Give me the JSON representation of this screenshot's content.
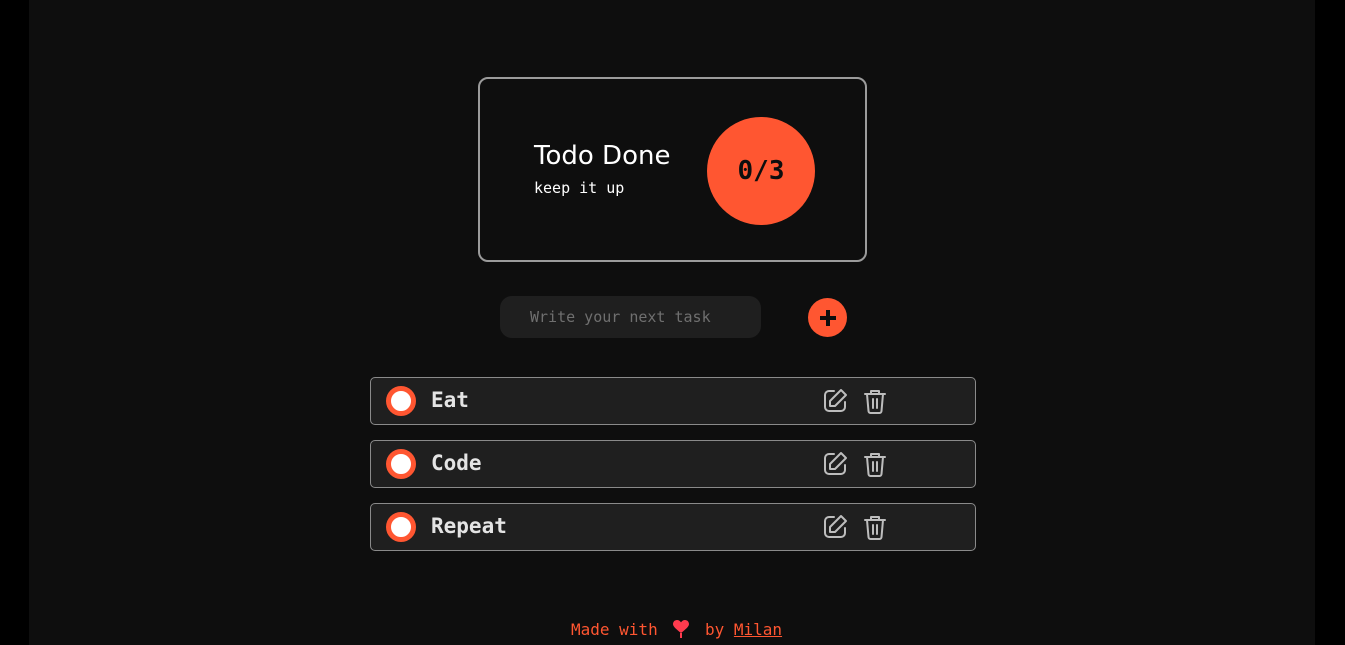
{
  "stats": {
    "title": "Todo Done",
    "subtitle": "keep it up",
    "count": "0/3",
    "done": 0,
    "total": 3
  },
  "input": {
    "placeholder": "Write your next task",
    "value": ""
  },
  "add_button": {
    "icon": "plus-icon"
  },
  "todos": [
    {
      "text": "Eat",
      "done": false
    },
    {
      "text": "Code",
      "done": false
    },
    {
      "text": "Repeat",
      "done": false
    }
  ],
  "footer": {
    "prefix": "Made with",
    "by": "by",
    "author": "Milan",
    "heart_icon": "heart-icon"
  },
  "colors": {
    "accent": "#ff5631",
    "background": "#0e0e0e",
    "card_bg": "#1f1f1f",
    "border": "#8a8a8a"
  }
}
